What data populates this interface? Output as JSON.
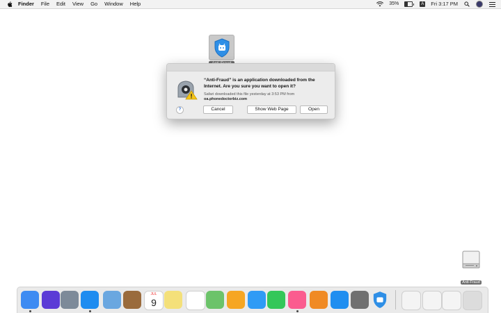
{
  "menubar": {
    "app_name": "Finder",
    "menus": [
      "File",
      "Edit",
      "View",
      "Go",
      "Window",
      "Help"
    ],
    "battery_percent": "35%",
    "battery_level": 0.35,
    "input_source": "A",
    "clock": "Fri 3:17 PM"
  },
  "desktop_file": {
    "label": "Anti-Fraud",
    "icon": "anti-fraud-shield-icon"
  },
  "dialog": {
    "title": "“Anti-Fraud” is an application downloaded from the Internet. Are you sure you want to open it?",
    "info": "Safari downloaded this file yesterday at 3:53 PM from",
    "domain": "oa.phonedoctorbiz.com",
    "help_label": "?",
    "cancel_label": "Cancel",
    "web_label": "Show Web Page",
    "open_label": "Open"
  },
  "drive": {
    "label": "Anti-Fraud",
    "icon": "disk-drive-icon"
  },
  "dock": {
    "apps": [
      {
        "name": "finder-icon",
        "color": "#3d8bf2",
        "running": true
      },
      {
        "name": "siri-icon",
        "color": "#5b3bd6",
        "running": false
      },
      {
        "name": "launchpad-icon",
        "color": "#7d8a99",
        "running": false
      },
      {
        "name": "safari-icon",
        "color": "#1e8cf0",
        "running": true
      },
      {
        "name": "mail-icon",
        "color": "#6aa7e0",
        "running": false
      },
      {
        "name": "contacts-icon",
        "color": "#9a6b3c",
        "running": false
      },
      {
        "name": "calendar-icon",
        "color": "#ffffff",
        "running": false
      },
      {
        "name": "notes-icon",
        "color": "#f4e07a",
        "running": false
      },
      {
        "name": "reminders-icon",
        "color": "#ffffff",
        "running": false
      },
      {
        "name": "maps-icon",
        "color": "#6cc36a",
        "running": false
      },
      {
        "name": "photos-icon",
        "color": "#f6a623",
        "running": false
      },
      {
        "name": "messages-icon",
        "color": "#2f9bf5",
        "running": false
      },
      {
        "name": "facetime-icon",
        "color": "#34c759",
        "running": false
      },
      {
        "name": "itunes-icon",
        "color": "#fb5c8f",
        "running": true
      },
      {
        "name": "books-icon",
        "color": "#f08a24",
        "running": false
      },
      {
        "name": "app-store-icon",
        "color": "#1f8ef0",
        "running": false
      },
      {
        "name": "system-preferences-icon",
        "color": "#707070",
        "running": false
      },
      {
        "name": "anti-fraud-icon",
        "color": "#2f8fe6",
        "running": false
      },
      {
        "name": "document-icon",
        "color": "#f4f4f4",
        "running": false
      },
      {
        "name": "screenshot-file-icon",
        "color": "#f4f4f4",
        "running": false
      },
      {
        "name": "screenshot-file-2-icon",
        "color": "#f4f4f4",
        "running": false
      },
      {
        "name": "trash-icon",
        "color": "#dcdcdc",
        "running": false
      }
    ],
    "calendar_month": "JUL",
    "calendar_day": "9"
  }
}
